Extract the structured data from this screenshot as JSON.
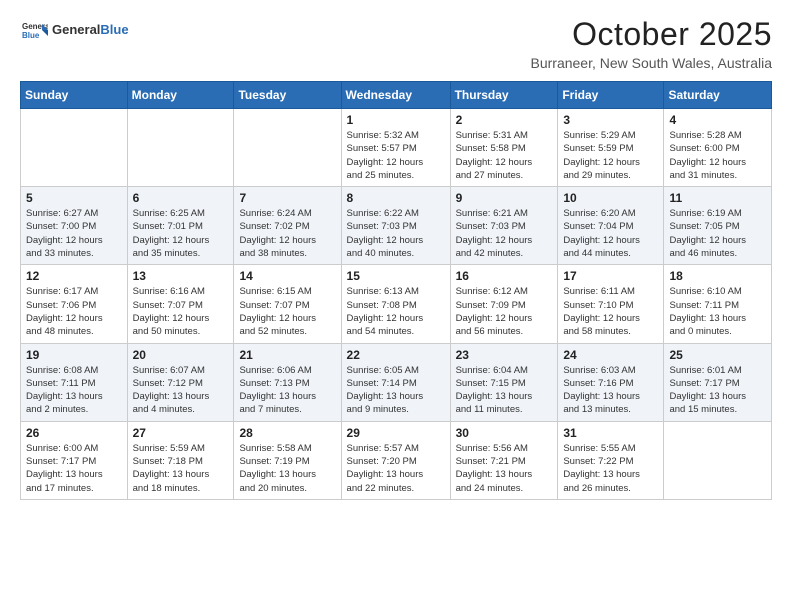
{
  "header": {
    "logo_general": "General",
    "logo_blue": "Blue",
    "month_title": "October 2025",
    "location": "Burraneer, New South Wales, Australia"
  },
  "weekdays": [
    "Sunday",
    "Monday",
    "Tuesday",
    "Wednesday",
    "Thursday",
    "Friday",
    "Saturday"
  ],
  "weeks": [
    [
      {
        "day": "",
        "info": ""
      },
      {
        "day": "",
        "info": ""
      },
      {
        "day": "",
        "info": ""
      },
      {
        "day": "1",
        "info": "Sunrise: 5:32 AM\nSunset: 5:57 PM\nDaylight: 12 hours\nand 25 minutes."
      },
      {
        "day": "2",
        "info": "Sunrise: 5:31 AM\nSunset: 5:58 PM\nDaylight: 12 hours\nand 27 minutes."
      },
      {
        "day": "3",
        "info": "Sunrise: 5:29 AM\nSunset: 5:59 PM\nDaylight: 12 hours\nand 29 minutes."
      },
      {
        "day": "4",
        "info": "Sunrise: 5:28 AM\nSunset: 6:00 PM\nDaylight: 12 hours\nand 31 minutes."
      }
    ],
    [
      {
        "day": "5",
        "info": "Sunrise: 6:27 AM\nSunset: 7:00 PM\nDaylight: 12 hours\nand 33 minutes."
      },
      {
        "day": "6",
        "info": "Sunrise: 6:25 AM\nSunset: 7:01 PM\nDaylight: 12 hours\nand 35 minutes."
      },
      {
        "day": "7",
        "info": "Sunrise: 6:24 AM\nSunset: 7:02 PM\nDaylight: 12 hours\nand 38 minutes."
      },
      {
        "day": "8",
        "info": "Sunrise: 6:22 AM\nSunset: 7:03 PM\nDaylight: 12 hours\nand 40 minutes."
      },
      {
        "day": "9",
        "info": "Sunrise: 6:21 AM\nSunset: 7:03 PM\nDaylight: 12 hours\nand 42 minutes."
      },
      {
        "day": "10",
        "info": "Sunrise: 6:20 AM\nSunset: 7:04 PM\nDaylight: 12 hours\nand 44 minutes."
      },
      {
        "day": "11",
        "info": "Sunrise: 6:19 AM\nSunset: 7:05 PM\nDaylight: 12 hours\nand 46 minutes."
      }
    ],
    [
      {
        "day": "12",
        "info": "Sunrise: 6:17 AM\nSunset: 7:06 PM\nDaylight: 12 hours\nand 48 minutes."
      },
      {
        "day": "13",
        "info": "Sunrise: 6:16 AM\nSunset: 7:07 PM\nDaylight: 12 hours\nand 50 minutes."
      },
      {
        "day": "14",
        "info": "Sunrise: 6:15 AM\nSunset: 7:07 PM\nDaylight: 12 hours\nand 52 minutes."
      },
      {
        "day": "15",
        "info": "Sunrise: 6:13 AM\nSunset: 7:08 PM\nDaylight: 12 hours\nand 54 minutes."
      },
      {
        "day": "16",
        "info": "Sunrise: 6:12 AM\nSunset: 7:09 PM\nDaylight: 12 hours\nand 56 minutes."
      },
      {
        "day": "17",
        "info": "Sunrise: 6:11 AM\nSunset: 7:10 PM\nDaylight: 12 hours\nand 58 minutes."
      },
      {
        "day": "18",
        "info": "Sunrise: 6:10 AM\nSunset: 7:11 PM\nDaylight: 13 hours\nand 0 minutes."
      }
    ],
    [
      {
        "day": "19",
        "info": "Sunrise: 6:08 AM\nSunset: 7:11 PM\nDaylight: 13 hours\nand 2 minutes."
      },
      {
        "day": "20",
        "info": "Sunrise: 6:07 AM\nSunset: 7:12 PM\nDaylight: 13 hours\nand 4 minutes."
      },
      {
        "day": "21",
        "info": "Sunrise: 6:06 AM\nSunset: 7:13 PM\nDaylight: 13 hours\nand 7 minutes."
      },
      {
        "day": "22",
        "info": "Sunrise: 6:05 AM\nSunset: 7:14 PM\nDaylight: 13 hours\nand 9 minutes."
      },
      {
        "day": "23",
        "info": "Sunrise: 6:04 AM\nSunset: 7:15 PM\nDaylight: 13 hours\nand 11 minutes."
      },
      {
        "day": "24",
        "info": "Sunrise: 6:03 AM\nSunset: 7:16 PM\nDaylight: 13 hours\nand 13 minutes."
      },
      {
        "day": "25",
        "info": "Sunrise: 6:01 AM\nSunset: 7:17 PM\nDaylight: 13 hours\nand 15 minutes."
      }
    ],
    [
      {
        "day": "26",
        "info": "Sunrise: 6:00 AM\nSunset: 7:17 PM\nDaylight: 13 hours\nand 17 minutes."
      },
      {
        "day": "27",
        "info": "Sunrise: 5:59 AM\nSunset: 7:18 PM\nDaylight: 13 hours\nand 18 minutes."
      },
      {
        "day": "28",
        "info": "Sunrise: 5:58 AM\nSunset: 7:19 PM\nDaylight: 13 hours\nand 20 minutes."
      },
      {
        "day": "29",
        "info": "Sunrise: 5:57 AM\nSunset: 7:20 PM\nDaylight: 13 hours\nand 22 minutes."
      },
      {
        "day": "30",
        "info": "Sunrise: 5:56 AM\nSunset: 7:21 PM\nDaylight: 13 hours\nand 24 minutes."
      },
      {
        "day": "31",
        "info": "Sunrise: 5:55 AM\nSunset: 7:22 PM\nDaylight: 13 hours\nand 26 minutes."
      },
      {
        "day": "",
        "info": ""
      }
    ]
  ]
}
